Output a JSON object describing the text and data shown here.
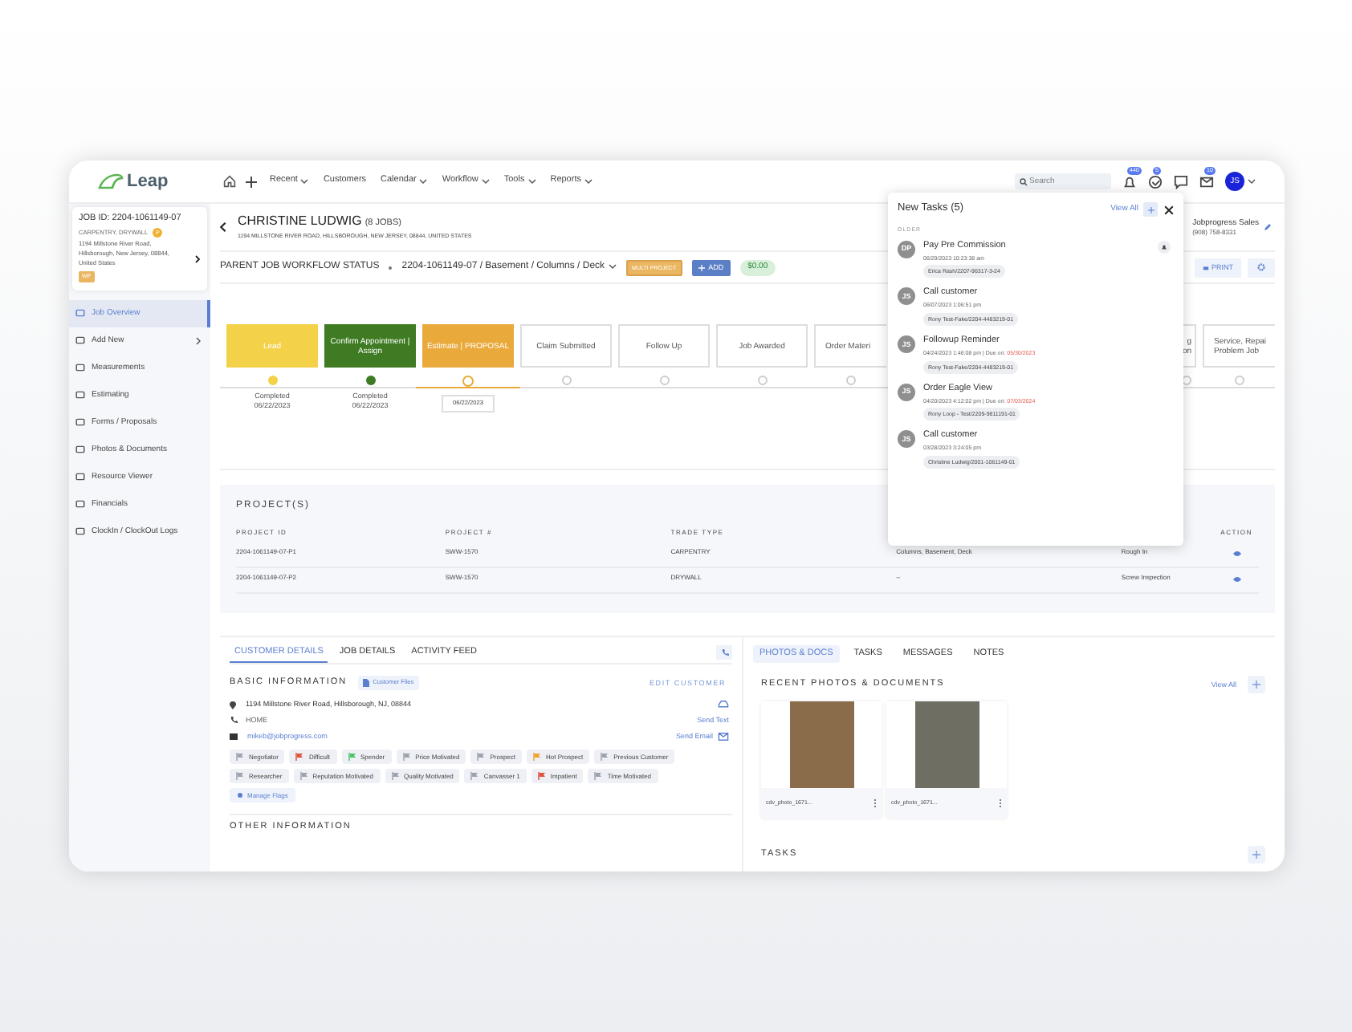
{
  "nav": {
    "logo": "Leap",
    "menus": [
      {
        "label": "Recent",
        "dropdown": true
      },
      {
        "label": "Customers",
        "dropdown": false
      },
      {
        "label": "Calendar",
        "dropdown": true
      },
      {
        "label": "Workflow",
        "dropdown": true
      },
      {
        "label": "Tools",
        "dropdown": true
      },
      {
        "label": "Reports",
        "dropdown": true
      }
    ],
    "search_placeholder": "Search",
    "badges": {
      "notifications": "440",
      "tasks": "5",
      "mail": "10"
    },
    "avatar": "JS"
  },
  "job_card": {
    "job_id": "JOB ID: 2204-1061149-07",
    "trades": "CARPENTRY, DRYWALL",
    "trade_badge": "P",
    "address": "1194 Millstone River Road, Hillsborough, New Jersey, 08844, United States",
    "status_badge": "WP"
  },
  "sidebar": [
    {
      "label": "Job Overview",
      "selected": true,
      "submenu": false
    },
    {
      "label": "Add New",
      "selected": false,
      "submenu": true
    },
    {
      "label": "Measurements",
      "selected": false,
      "submenu": false
    },
    {
      "label": "Estimating",
      "selected": false,
      "submenu": false
    },
    {
      "label": "Forms / Proposals",
      "selected": false,
      "submenu": false
    },
    {
      "label": "Photos & Documents",
      "selected": false,
      "submenu": false
    },
    {
      "label": "Resource Viewer",
      "selected": false,
      "submenu": false
    },
    {
      "label": "Financials",
      "selected": false,
      "submenu": false
    },
    {
      "label": "ClockIn / ClockOut Logs",
      "selected": false,
      "submenu": false
    }
  ],
  "customer": {
    "name": "CHRISTINE LUDWIG",
    "jobs": "(8 JOBS)",
    "address": "1194 MILLSTONE RIVER ROAD, HILLSBOROUGH, NEW JERSEY, 08844, UNITED STATES",
    "rep_name": "Jobprogress Sales",
    "rep_phone": "(908) 758-8331"
  },
  "workflow": {
    "label": "PARENT JOB WORKFLOW STATUS",
    "job_path": "2204-1061149-07 / Basement / Columns / Deck",
    "badge": "MULTI PROJECT",
    "add_button": "ADD",
    "amount": "$0.00",
    "print_button": "PRINT",
    "stages": [
      {
        "kind": "whole",
        "label": "Lead",
        "completed": true,
        "current": false,
        "color": "#f3d24a",
        "status": "Completed",
        "date": "06/22/2023"
      },
      {
        "kind": "whole",
        "label": "Confirm Appointment | Assign",
        "completed": true,
        "current": false,
        "color": "#3e7b22",
        "status": "Completed",
        "date": "06/22/2023"
      },
      {
        "kind": "whole",
        "label": "Estimate | PROPOSAL",
        "completed": false,
        "current": true,
        "color": "#eaa93b",
        "date": "06/22/2023"
      },
      {
        "kind": "whole",
        "label": "Claim Submitted",
        "completed": false,
        "current": false
      },
      {
        "kind": "whole",
        "label": "Follow Up",
        "completed": false,
        "current": false
      },
      {
        "kind": "whole",
        "label": "Job Awarded",
        "completed": false,
        "current": false
      },
      {
        "kind": "head",
        "label": "Order Materi",
        "completed": false,
        "current": false
      },
      {
        "kind": "tail",
        "label": "g on",
        "completed": false,
        "current": false
      },
      {
        "kind": "head",
        "label": "Service, Repai Problem Job",
        "completed": false,
        "current": false
      }
    ]
  },
  "tasks_popup": {
    "title": "New Tasks (5)",
    "view_all": "View All",
    "group": "OLDER",
    "tasks": [
      {
        "initials": "DP",
        "title": "Pay Pre Commission",
        "created": "06/29/2023 10:23:38 am",
        "tag": "Erica Rash/2207-96317-3-24",
        "reminder": true
      },
      {
        "initials": "JS",
        "title": "Call customer",
        "created": "06/07/2023 1:06:51 pm",
        "tag": "Rony Test-Fake/2204-4483219-01",
        "reminder": false
      },
      {
        "initials": "JS",
        "title": "Followup Reminder",
        "created": "04/24/2023 1:46:08 pm | Due on:",
        "due": "05/30/2023",
        "tag": "Rony Test-Fake/2204-4483219-01",
        "reminder": false
      },
      {
        "initials": "JS",
        "title": "Order Eagle View",
        "created": "04/20/2023 4:12:02 pm | Due on:",
        "due": "07/03/2024",
        "tag": "Rony Loop - Test/2209-9811191-01",
        "reminder": false
      },
      {
        "initials": "JS",
        "title": "Call customer",
        "created": "03/28/2023 3:24:05 pm",
        "tag": "Christine Ludwig/2001-1061149-01",
        "reminder": false
      }
    ]
  },
  "projects": {
    "title": "PROJECT(S)",
    "columns": [
      "PROJECT ID",
      "PROJECT #",
      "TRADE TYPE",
      "",
      "",
      "ACTION"
    ],
    "rows": [
      [
        "2204-1061149-07-P1",
        "SWW-1570",
        "CARPENTRY",
        "Columns, Basement, Deck",
        "Rough In"
      ],
      [
        "2204-1061149-07-P2",
        "SWW-1570",
        "DRYWALL",
        "--",
        "Screw Inspection"
      ]
    ]
  },
  "customer_details": {
    "tabs": [
      {
        "label": "CUSTOMER DETAILS",
        "selected": true
      },
      {
        "label": "JOB DETAILS",
        "selected": false
      },
      {
        "label": "ACTIVITY FEED",
        "selected": false
      }
    ],
    "section": "BASIC INFORMATION",
    "files_button": "Customer Files",
    "edit_link": "EDIT CUSTOMER",
    "address": "1194 Millstone River Road, Hillsborough, NJ, 08844",
    "phone_label": "HOME",
    "send_text": "Send Text",
    "email": "mikeb@jobprogress.com",
    "send_email": "Send Email",
    "flags": [
      {
        "label": "Negotiator",
        "color": "#9ca3af"
      },
      {
        "label": "Difficult",
        "color": "#e0533c"
      },
      {
        "label": "Spender",
        "color": "#4cc46a"
      },
      {
        "label": "Price Motivated",
        "color": "#9ca3af"
      },
      {
        "label": "Prospect",
        "color": "#9ca3af"
      },
      {
        "label": "Hot Prospect",
        "color": "#f0a32c"
      },
      {
        "label": "Previous Customer",
        "color": "#9ca3af"
      },
      {
        "label": "Researcher",
        "color": "#9ca3af"
      },
      {
        "label": "Reputation Motivated",
        "color": "#9ca3af"
      },
      {
        "label": "Quality Motivated",
        "color": "#9ca3af"
      },
      {
        "label": "Canvasser 1",
        "color": "#9ca3af"
      },
      {
        "label": "Impatient",
        "color": "#e0533c"
      },
      {
        "label": "Time Motivated",
        "color": "#9ca3af"
      }
    ],
    "manage_flags": "Manage Flags",
    "other_section": "OTHER INFORMATION"
  },
  "docs": {
    "tabs": [
      {
        "label": "PHOTOS & DOCS",
        "selected": true
      },
      {
        "label": "TASKS",
        "selected": false
      },
      {
        "label": "MESSAGES",
        "selected": false
      },
      {
        "label": "NOTES",
        "selected": false
      }
    ],
    "section": "RECENT PHOTOS & DOCUMENTS",
    "view_all": "View All",
    "files": [
      {
        "name": "cdv_photo_1671..."
      },
      {
        "name": "cdv_photo_1671..."
      }
    ],
    "tasks_section": "TASKS"
  }
}
